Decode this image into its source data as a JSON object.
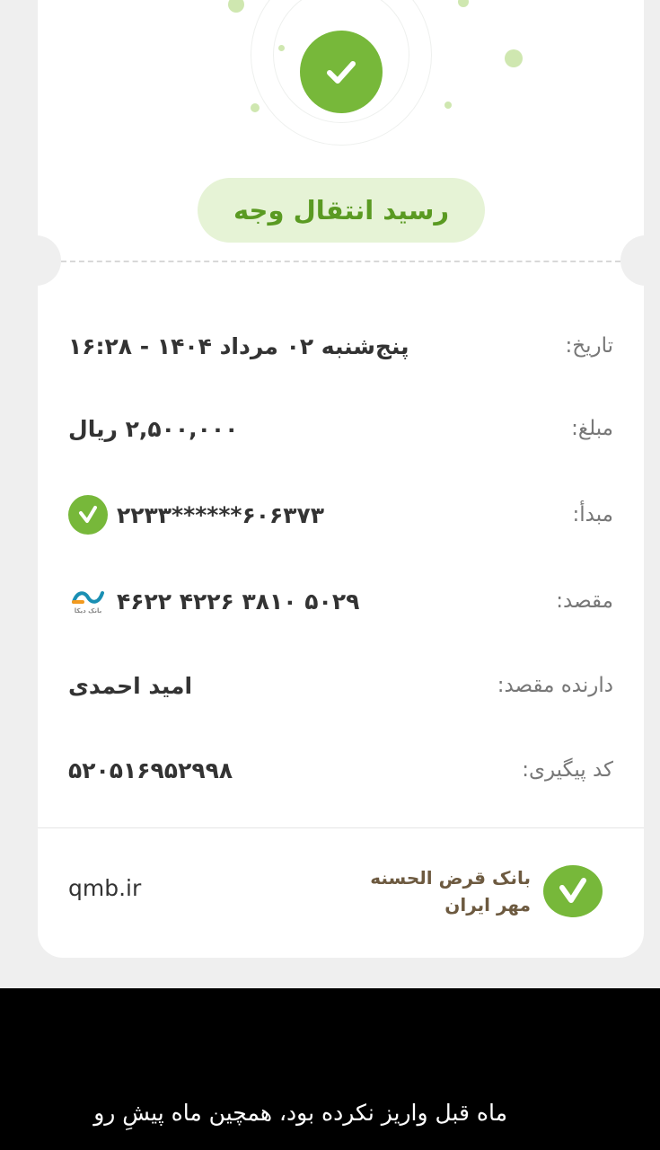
{
  "receipt": {
    "title": "رسید انتقال وجه",
    "rows": [
      {
        "label": "تاریخ:",
        "value": "پنج‌شنبه ۰۲ مرداد ۱۴۰۴ - ۱۶:۲۸"
      },
      {
        "label": "مبلغ:",
        "value": "۲,۵۰۰,۰۰۰ ریال"
      },
      {
        "label": "مبدأ:",
        "value": "۶۰۶۳۷۳******۲۲۳۳",
        "icon": "bank-check-icon"
      },
      {
        "label": "مقصد:",
        "value": "۵۰۲۹ ۳۸۱۰ ۴۲۲۶ ۴۶۲۲",
        "icon": "bank-dey-logo-icon",
        "icon_caption": "بانک دیکا"
      },
      {
        "label": "دارنده مقصد:",
        "value": "امید احمدی"
      },
      {
        "label": "کد پیگیری:",
        "value": "۵۲۰۵۱۶۹۵۲۹۹۸"
      }
    ],
    "footer": {
      "site": "qmb.ir",
      "bank_name_line1": "بانک قرض الحسنه",
      "bank_name_line2": "مهر ایران"
    }
  },
  "caption": "ماه قبل واریز نکرده بود، همچین ماه پیشِ رو",
  "colors": {
    "accent": "#77b83a",
    "pill_bg": "#e6f3d6",
    "brand_text": "#6d5a40"
  }
}
